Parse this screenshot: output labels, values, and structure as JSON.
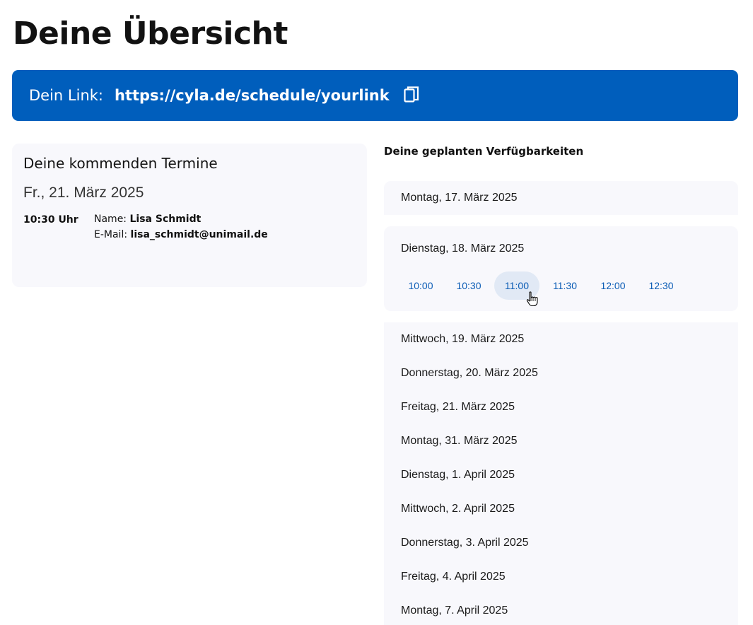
{
  "page": {
    "title": "Deine Übersicht"
  },
  "link_bar": {
    "label": "Dein Link:",
    "url": "https://cyla.de/schedule/yourlink",
    "copy_icon": "copy-icon",
    "background_color": "#005ebc"
  },
  "appointments": {
    "title": "Deine kommenden Termine",
    "date": "Fr., 21. März 2025",
    "items": [
      {
        "time": "10:30 Uhr",
        "name_label": "Name:",
        "name": "Lisa Schmidt",
        "email_label": "E-Mail:",
        "email": "lisa_schmidt@unimail.de"
      }
    ]
  },
  "availability": {
    "heading": "Deine geplanten Verfügbarkeiten",
    "days": [
      "Montag, 17. März 2025",
      "Dienstag, 18. März 2025",
      "Mittwoch, 19. März 2025",
      "Donnerstag, 20. März 2025",
      "Freitag, 21. März 2025",
      "Montag, 31. März 2025",
      "Dienstag, 1. April 2025",
      "Mittwoch, 2. April 2025",
      "Donnerstag, 3. April 2025",
      "Freitag, 4. April 2025",
      "Montag, 7. April 2025"
    ],
    "expanded_day_slots": [
      "10:00",
      "10:30",
      "11:00",
      "11:30",
      "12:00",
      "12:30"
    ],
    "hovered_slot": "11:00",
    "slot_color": "#0b5cb5"
  }
}
